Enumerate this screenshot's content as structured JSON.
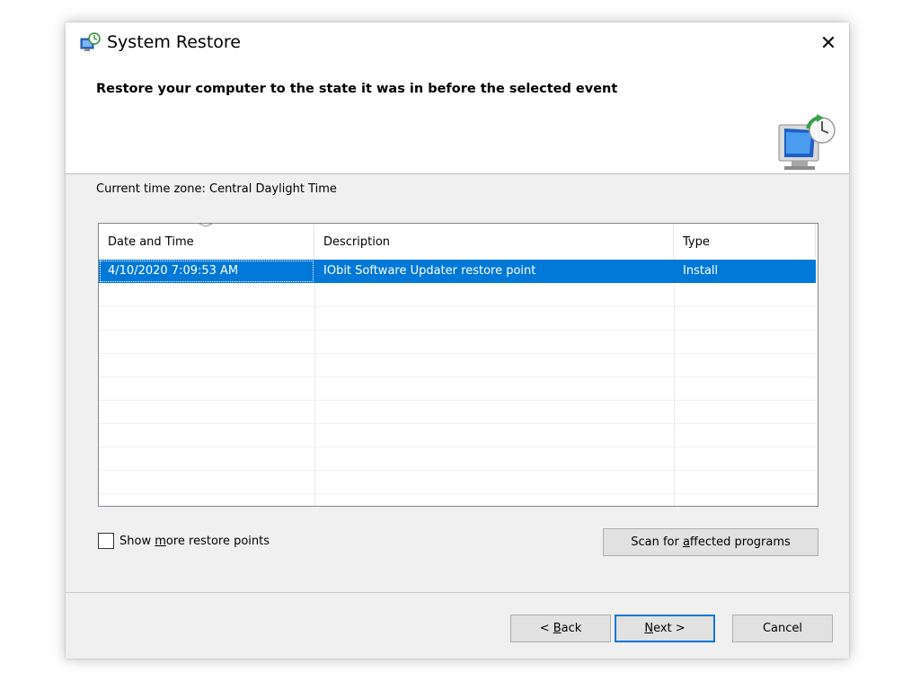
{
  "window": {
    "title": "System Restore",
    "close_glyph": "✕",
    "icon": "system-restore-icon"
  },
  "header": {
    "heading": "Restore your computer to the state it was in before the selected event",
    "icon": "monitor-restore-icon"
  },
  "timezone": {
    "label": "Current time zone: Central Daylight Time"
  },
  "list": {
    "columns": [
      "Date and Time",
      "Description",
      "Type"
    ],
    "sort_indicator": "﹀",
    "rows": [
      {
        "date": "4/10/2020 7:09:53 AM",
        "description": "IObit Software Updater restore point",
        "type": "Install",
        "selected": true
      }
    ]
  },
  "options": {
    "show_more_pre": "Show ",
    "show_more_key": "m",
    "show_more_post": "ore restore points",
    "show_more_checked": false
  },
  "buttons": {
    "scan_pre": "Scan for ",
    "scan_key": "a",
    "scan_post": "ffected programs",
    "back_pre": "< ",
    "back_key": "B",
    "back_post": "ack",
    "next_key": "N",
    "next_post": "ext >",
    "cancel": "Cancel"
  },
  "colors": {
    "selection": "#0078d7",
    "dialog_bg": "#f0f0f0"
  }
}
